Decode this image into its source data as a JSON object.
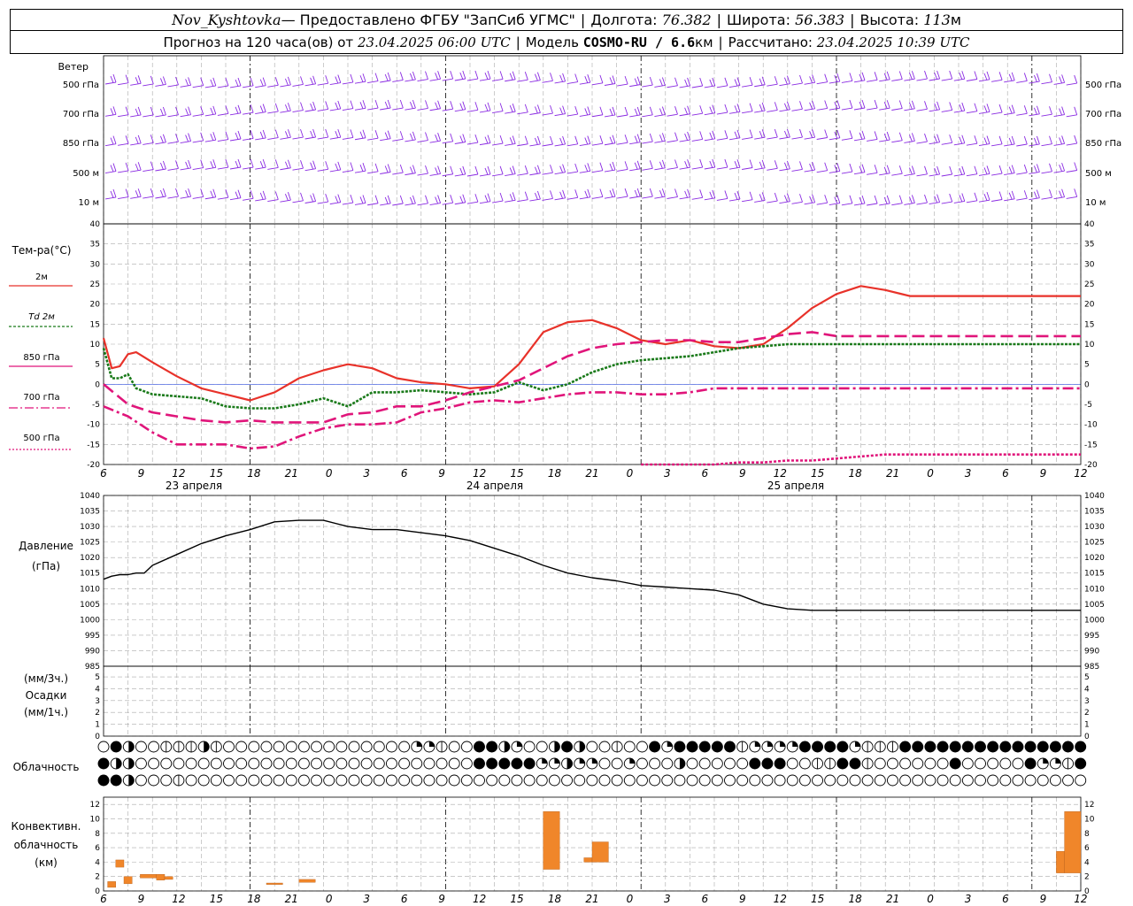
{
  "header": {
    "station": "Nov_Kyshtovka",
    "provider": " — Предоставлено ФГБУ \"ЗапСиб УГМС\"",
    "lon_label": "Долгота:",
    "lon_value": "76.382",
    "lat_label": "Широта:",
    "lat_value": "56.383",
    "alt_label": "Высота:",
    "alt_value": "113",
    "alt_unit": "м",
    "forecast_text": "Прогноз на 120 часа(ов) от",
    "forecast_start": "23.04.2025 06:00 UTC",
    "model_label": "Модель",
    "model_name": "COSMO-RU / 6.6",
    "model_unit": "км",
    "calc_label": "Рассчитано:",
    "calc_time": "23.04.2025 10:39 UTC"
  },
  "labels": {
    "wind_title": "Ветер",
    "wind_levels": [
      "500 гПа",
      "700 гПа",
      "850 гПа",
      "500 м",
      "10  м"
    ],
    "temp_title": "Тем-ра(°С)",
    "temp_legend": [
      "2м",
      "Td  2м",
      "850 гПа",
      "700 гПа",
      "500 гПа"
    ],
    "pressure_title_1": "Давление",
    "pressure_title_2": "(гПа)",
    "precip_1": "(мм/3ч.)",
    "precip_2": "Осадки",
    "precip_3": "(мм/1ч.)",
    "cloud_title": "Облачность",
    "conv_1": "Конвективн.",
    "conv_2": "облачность",
    "conv_3": "(км)",
    "days": [
      "23 апреля",
      "24 апреля",
      "25 апреля"
    ]
  },
  "colors": {
    "wind": "#8a2be2",
    "t2m": "#e8322a",
    "td2m": "#1a7a1a",
    "t850": "#e0157a",
    "t700": "#e0157a",
    "t500": "#e0157a",
    "pressure": "#000000",
    "conv": "#f0862a"
  },
  "chart_data": [
    {
      "type": "line",
      "title": "Тем-ра(°С)",
      "x_hour_ticks": [
        "6",
        "9",
        "12",
        "15",
        "18",
        "21",
        "0",
        "3",
        "6",
        "9",
        "12",
        "15",
        "18",
        "21",
        "0",
        "3",
        "6",
        "9",
        "12",
        "15",
        "18",
        "21",
        "0",
        "3",
        "6",
        "9",
        "12"
      ],
      "ylim": [
        -20,
        40
      ],
      "yticks": [
        -20,
        -15,
        -10,
        -5,
        0,
        5,
        10,
        15,
        20,
        25,
        30,
        35,
        40
      ],
      "series": [
        {
          "name": "2м",
          "x": [
            0,
            1,
            2,
            3,
            4,
            6,
            9,
            12,
            15,
            18,
            21,
            24,
            27,
            30,
            33,
            36,
            39,
            42,
            45,
            48,
            51,
            54,
            57,
            60,
            63,
            66,
            69,
            72,
            75,
            78,
            81,
            84,
            87,
            90,
            93,
            96,
            99,
            102,
            105,
            108,
            111,
            114,
            117,
            120
          ],
          "y": [
            11.5,
            4,
            4.5,
            7.5,
            8,
            5.5,
            2,
            -1,
            -2.5,
            -4,
            -2,
            1.5,
            3.5,
            5,
            4,
            1.5,
            0.5,
            0,
            -1,
            -0.5,
            5,
            13,
            15.5,
            16,
            14,
            11,
            10,
            11,
            9.5,
            9,
            10,
            14,
            19,
            22.5,
            24.5,
            23.5,
            22,
            22,
            22,
            22,
            22,
            22,
            22,
            22
          ]
        },
        {
          "name": "Td  2м",
          "x": [
            0,
            1,
            2,
            3,
            4,
            6,
            9,
            12,
            15,
            18,
            21,
            24,
            27,
            30,
            33,
            36,
            39,
            42,
            45,
            48,
            51,
            54,
            57,
            60,
            63,
            66,
            69,
            72,
            75,
            78,
            81,
            84,
            87,
            90,
            93,
            96,
            99,
            102,
            105,
            108,
            111,
            114,
            117,
            120
          ],
          "y": [
            9,
            1.5,
            1.5,
            2.5,
            -1,
            -2.5,
            -3,
            -3.5,
            -5.5,
            -6,
            -6,
            -5,
            -3.5,
            -5.5,
            -2,
            -2,
            -1.5,
            -2,
            -2.5,
            -2,
            0.5,
            -1.5,
            0,
            3,
            5,
            6,
            6.5,
            7,
            8,
            9,
            9.5,
            10,
            10,
            10,
            10,
            10,
            10,
            10,
            10,
            10,
            10,
            10,
            10,
            10
          ]
        },
        {
          "name": "850 гПа",
          "x": [
            0,
            3,
            6,
            9,
            12,
            15,
            18,
            21,
            24,
            27,
            30,
            33,
            36,
            39,
            42,
            45,
            48,
            51,
            54,
            57,
            60,
            63,
            66,
            69,
            72,
            75,
            78,
            81,
            84,
            87,
            90,
            93,
            96,
            99,
            102,
            105,
            108,
            111,
            114,
            117,
            120
          ],
          "y": [
            0,
            -5,
            -7,
            -8,
            -9,
            -9.5,
            -9,
            -9.5,
            -9.5,
            -9.5,
            -7.5,
            -7,
            -5.5,
            -5.5,
            -4,
            -2,
            -0.5,
            1,
            4,
            7,
            9,
            10,
            10.5,
            11,
            11,
            10.5,
            10.5,
            11.5,
            12.5,
            13,
            12,
            12,
            12,
            12,
            12,
            12,
            12,
            12,
            12,
            12,
            12
          ]
        },
        {
          "name": "700 гПа",
          "x": [
            0,
            3,
            6,
            9,
            12,
            15,
            18,
            21,
            24,
            27,
            30,
            33,
            36,
            39,
            42,
            45,
            48,
            51,
            54,
            57,
            60,
            63,
            66,
            69,
            72,
            75,
            78,
            81,
            84,
            87,
            90,
            93,
            96,
            99,
            102,
            105,
            108,
            111,
            114,
            117,
            120
          ],
          "y": [
            -5.5,
            -8,
            -12,
            -15,
            -15,
            -15,
            -16,
            -15.5,
            -13,
            -11,
            -10,
            -10,
            -9.5,
            -7,
            -6,
            -4.5,
            -4,
            -4.5,
            -3.5,
            -2.5,
            -2,
            -2,
            -2.5,
            -2.5,
            -2,
            -1,
            -1,
            -1,
            -1,
            -1,
            -1,
            -1,
            -1,
            -1,
            -1,
            -1,
            -1,
            -1,
            -1,
            -1,
            -1
          ]
        },
        {
          "name": "500 гПа",
          "x": [
            66,
            69,
            72,
            75,
            78,
            81,
            84,
            87,
            90,
            93,
            96,
            99,
            102,
            105,
            108,
            111,
            114,
            117,
            120
          ],
          "y": [
            -20,
            -20,
            -20,
            -20,
            -19.5,
            -19.5,
            -19,
            -19,
            -18.5,
            -18,
            -17.5,
            -17.5,
            -17.5,
            -17.5,
            -17.5,
            -17.5,
            -17.5,
            -17.5,
            -17.5
          ]
        }
      ]
    },
    {
      "type": "line",
      "title": "Давление (гПа)",
      "ylim": [
        985,
        1040
      ],
      "yticks": [
        985,
        990,
        995,
        1000,
        1005,
        1010,
        1015,
        1020,
        1025,
        1030,
        1035,
        1040
      ],
      "series": [
        {
          "name": "Давление",
          "x": [
            0,
            1,
            2,
            3,
            4,
            5,
            6,
            9,
            12,
            15,
            18,
            21,
            24,
            27,
            30,
            33,
            36,
            39,
            42,
            45,
            48,
            51,
            54,
            57,
            60,
            63,
            66,
            69,
            72,
            75,
            78,
            81,
            84,
            87,
            90,
            93,
            96,
            99,
            102,
            105,
            108,
            111,
            114,
            117,
            120
          ],
          "y": [
            1013,
            1014,
            1014.5,
            1014.5,
            1015,
            1015,
            1017.5,
            1021,
            1024.5,
            1027,
            1029,
            1031.5,
            1032,
            1032,
            1030,
            1029,
            1029,
            1028,
            1027,
            1025.5,
            1023,
            1020.5,
            1017.5,
            1015,
            1013.5,
            1012.5,
            1011,
            1010.5,
            1010,
            1009.5,
            1008,
            1005,
            1003.5,
            1003,
            1003,
            1003,
            1003,
            1003,
            1003,
            1003,
            1003,
            1003,
            1003,
            1003,
            1003
          ]
        }
      ]
    },
    {
      "type": "bar",
      "title": "Конвективн. облачность (км)",
      "ylim": [
        0,
        13
      ],
      "yticks": [
        0,
        2,
        4,
        6,
        8,
        10,
        12
      ],
      "bars": [
        {
          "x0": 0.5,
          "x1": 1.5,
          "bottom": 0.5,
          "top": 1.3
        },
        {
          "x0": 1.5,
          "x1": 2.5,
          "bottom": 3.3,
          "top": 4.3
        },
        {
          "x0": 2.5,
          "x1": 3.5,
          "bottom": 1.0,
          "top": 2.0
        },
        {
          "x0": 4.5,
          "x1": 6.5,
          "bottom": 1.8,
          "top": 2.3
        },
        {
          "x0": 6.5,
          "x1": 7.5,
          "bottom": 1.5,
          "top": 2.3
        },
        {
          "x0": 7.5,
          "x1": 8.5,
          "bottom": 1.6,
          "top": 2.0
        },
        {
          "x0": 20,
          "x1": 22,
          "bottom": 0.9,
          "top": 1.1
        },
        {
          "x0": 24,
          "x1": 26,
          "bottom": 1.2,
          "top": 1.6
        },
        {
          "x0": 54,
          "x1": 56,
          "bottom": 3.0,
          "top": 11.0
        },
        {
          "x0": 59,
          "x1": 60,
          "bottom": 4.0,
          "top": 4.6
        },
        {
          "x0": 60,
          "x1": 62,
          "bottom": 4.0,
          "top": 6.8
        },
        {
          "x0": 117,
          "x1": 118,
          "bottom": 2.5,
          "top": 5.5
        },
        {
          "x0": 118,
          "x1": 120,
          "bottom": 2.5,
          "top": 11.0
        }
      ]
    }
  ]
}
